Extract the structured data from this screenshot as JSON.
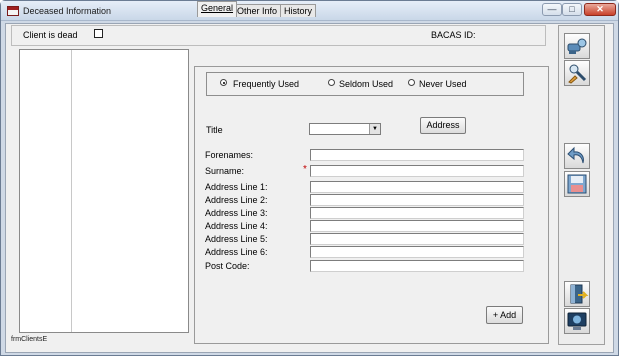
{
  "window": {
    "title": "Deceased Information",
    "controls": {
      "minimize": "—",
      "maximize": "□",
      "close": "✕"
    }
  },
  "header": {
    "client_dead_label": "Client is dead",
    "client_dead_checked": false,
    "bacas_label": "BACAS ID:",
    "bacas_value": ""
  },
  "tabs": [
    {
      "label": "General",
      "active": true
    },
    {
      "label": "Other Info",
      "active": false
    },
    {
      "label": "History",
      "active": false
    }
  ],
  "usage_filter": {
    "options": [
      "Frequently Used",
      "Seldom Used",
      "Never Used"
    ],
    "selected": "Frequently Used"
  },
  "form": {
    "title_label": "Title",
    "title_value": "",
    "address_button": "Address",
    "forenames_label": "Forenames:",
    "surname_label": "Surname:",
    "required_marker": "*",
    "address_lines": [
      "Address Line 1:",
      "Address Line 2:",
      "Address Line 3:",
      "Address Line 4:",
      "Address Line 5:",
      "Address Line 6:"
    ],
    "postcode_label": "Post Code:",
    "add_button": "+ Add"
  },
  "status": {
    "form_name": "frmClientsE"
  },
  "sidebar_tools": [
    "search-icon",
    "edit-icon",
    "undo-icon",
    "save-icon",
    "exit-door-icon",
    "monitor-icon"
  ],
  "colors": {
    "title_bar": "#c9d7e8",
    "close_button": "#c8412a",
    "required_marker": "#c00000"
  }
}
